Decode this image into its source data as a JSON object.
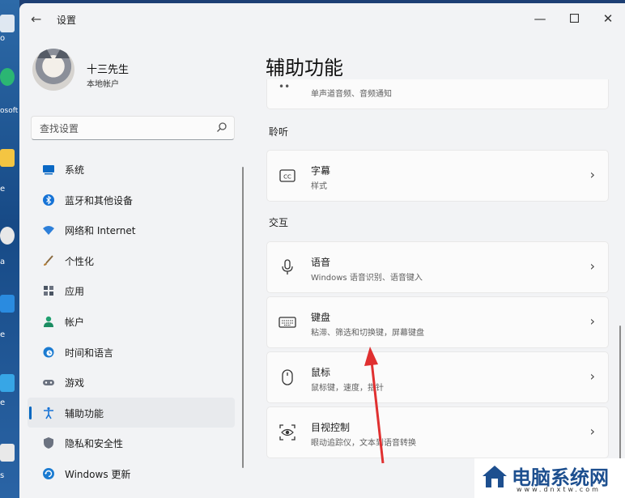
{
  "window": {
    "title": "设置",
    "back_icon": "arrow-left-icon",
    "controls": [
      "minimize-icon",
      "maximize-icon",
      "close-icon"
    ]
  },
  "desktop": {
    "labels": [
      "o",
      "osoft",
      "e",
      "a",
      "e",
      "e",
      "s"
    ]
  },
  "profile": {
    "name": "十三先生",
    "account_type": "本地帐户"
  },
  "search": {
    "placeholder": "查找设置",
    "icon": "search-icon"
  },
  "sidebar": {
    "items": [
      {
        "label": "系统",
        "icon": "system-icon",
        "color": "#0a68c4",
        "selected": false
      },
      {
        "label": "蓝牙和其他设备",
        "icon": "bluetooth-icon",
        "color": "#1673d6",
        "selected": false
      },
      {
        "label": "网络和 Internet",
        "icon": "wifi-icon",
        "color": "#2d7fd9",
        "selected": false
      },
      {
        "label": "个性化",
        "icon": "brush-icon",
        "color": "#b27a2f",
        "selected": false
      },
      {
        "label": "应用",
        "icon": "apps-icon",
        "color": "#4b5563",
        "selected": false
      },
      {
        "label": "帐户",
        "icon": "account-icon",
        "color": "#20a070",
        "selected": false
      },
      {
        "label": "时间和语言",
        "icon": "globe-clock-icon",
        "color": "#1b7bd1",
        "selected": false
      },
      {
        "label": "游戏",
        "icon": "gamepad-icon",
        "color": "#6b7280",
        "selected": false
      },
      {
        "label": "辅助功能",
        "icon": "accessibility-icon",
        "color": "#1673d6",
        "selected": true
      },
      {
        "label": "隐私和安全性",
        "icon": "shield-icon",
        "color": "#6b7280",
        "selected": false
      },
      {
        "label": "Windows 更新",
        "icon": "update-icon",
        "color": "#1b7bd1",
        "selected": false
      }
    ]
  },
  "main": {
    "page_title": "辅助功能",
    "partial_card": {
      "subtitle": "单声道音频、音频通知",
      "icon": "audio-icon"
    },
    "sections": [
      {
        "header": "聆听",
        "cards": [
          {
            "title": "字幕",
            "subtitle": "样式",
            "icon": "captions-icon"
          }
        ]
      },
      {
        "header": "交互",
        "cards": [
          {
            "title": "语音",
            "subtitle": "Windows 语音识别、语音键入",
            "icon": "microphone-icon"
          },
          {
            "title": "键盘",
            "subtitle": "粘滞、筛选和切换键，屏幕键盘",
            "icon": "keyboard-icon"
          },
          {
            "title": "鼠标",
            "subtitle": "鼠标键，速度，指针",
            "icon": "mouse-icon"
          },
          {
            "title": "目视控制",
            "subtitle": "眼动追踪仪，文本到语音转换",
            "icon": "eye-control-icon"
          }
        ]
      }
    ]
  },
  "overlay": {
    "annotation_arrow_color": "#e03030"
  },
  "watermark": {
    "title": "电脑系统网",
    "url": "www.dnxtw.com"
  },
  "colors": {
    "accent": "#0067c0",
    "window_bg": "#f2f3f5",
    "card_bg": "#fbfbfb"
  }
}
